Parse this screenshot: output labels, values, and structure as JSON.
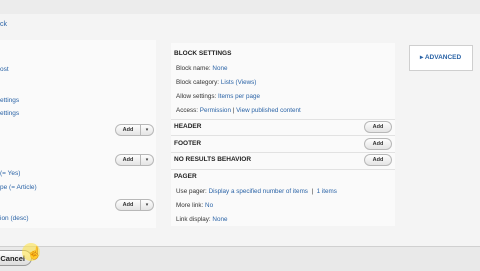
{
  "nav": {
    "back_link": "ck"
  },
  "left": {
    "items": [
      {
        "text": "ost"
      },
      {
        "text": "ettings"
      },
      {
        "text": "ettings"
      },
      {
        "text": "(= Yes)"
      },
      {
        "text": "pe (= Article)"
      },
      {
        "text": "ion (desc)"
      }
    ],
    "add_label": "Add",
    "dropdown_glyph": "▾"
  },
  "block_settings": {
    "heading": "BLOCK SETTINGS",
    "block_name_label": "Block name:",
    "block_name_value": "None",
    "block_category_label": "Block category:",
    "block_category_value": "Lists (Views)",
    "allow_settings_label": "Allow settings:",
    "allow_settings_value": "Items per page",
    "access_label": "Access:",
    "access_value": "Permission",
    "access_sep": "|",
    "access_link": "View published content"
  },
  "sections": {
    "header": "HEADER",
    "footer": "FOOTER",
    "no_results": "NO RESULTS BEHAVIOR",
    "add_label": "Add"
  },
  "pager": {
    "heading": "PAGER",
    "use_pager_label": "Use pager:",
    "use_pager_value": "Display a specified number of items",
    "sep": "|",
    "items_value": "1 items",
    "more_link_label": "More link:",
    "more_link_value": "No",
    "link_display_label": "Link display:",
    "link_display_value": "None"
  },
  "advanced": {
    "label": "▸ ADVANCED"
  },
  "footer": {
    "cancel_label": "Cancel"
  },
  "colors": {
    "link": "#2a63a6",
    "highlight": "#ffe13c"
  }
}
